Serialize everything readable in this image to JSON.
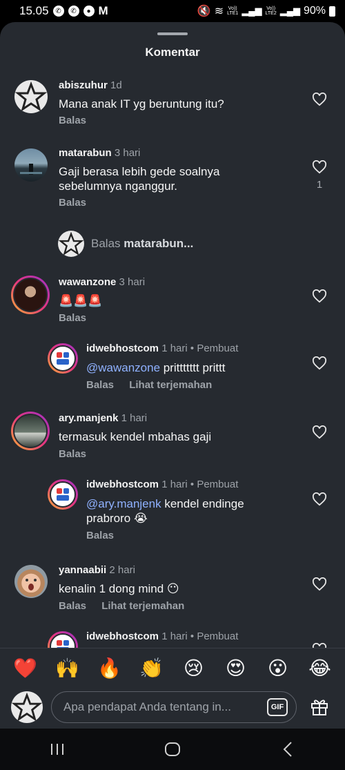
{
  "status": {
    "time": "15.05",
    "left_icons": [
      "whatsapp-icon",
      "whatsapp-icon",
      "record-icon",
      "gmail-icon"
    ],
    "lte1": "LTE1",
    "lte2": "LTE2",
    "vo1": "Vo))",
    "vo2": "Vo))",
    "battery": "90%"
  },
  "sheet": {
    "title": "Komentar"
  },
  "comments": [
    {
      "username": "abiszuhur",
      "time": "1d",
      "text": "Mana anak IT yg beruntung itu?",
      "actions": [
        "Balas"
      ],
      "likes": "",
      "avatar": "star-avatar-icon"
    },
    {
      "username": "matarabun",
      "time": "3 hari",
      "text": "Gaji berasa lebih gede soalnya sebelumnya nganggur.",
      "actions": [
        "Balas"
      ],
      "likes": "1",
      "avatar": "landscape-avatar-icon"
    },
    {
      "username": "wawanzone",
      "time": "3 hari",
      "text": "🚨🚨🚨",
      "actions": [
        "Balas"
      ],
      "likes": "",
      "avatar": "person-avatar-icon"
    },
    {
      "username": "idwebhostcom",
      "time": "1 hari",
      "creator": "Pembuat",
      "mention": "@wawanzone",
      "text": "prittttttt prittt",
      "actions": [
        "Balas",
        "Lihat terjemahan"
      ],
      "likes": "",
      "avatar": "idwebhost-logo-icon"
    },
    {
      "username": "ary.manjenk",
      "time": "1 hari",
      "text": "termasuk kendel mbahas gaji",
      "actions": [
        "Balas"
      ],
      "likes": "",
      "avatar": "person-avatar-icon"
    },
    {
      "username": "idwebhostcom",
      "time": "1 hari",
      "creator": "Pembuat",
      "mention": "@ary.manjenk",
      "text": "kendel endinge prabroro 😭",
      "actions": [
        "Balas"
      ],
      "likes": "",
      "avatar": "idwebhost-logo-icon"
    },
    {
      "username": "yannaabii",
      "time": "2 hari",
      "text": "kenalin 1 dong mind 😶",
      "actions": [
        "Balas",
        "Lihat terjemahan"
      ],
      "likes": "",
      "avatar": "child-avatar-icon"
    },
    {
      "username": "idwebhostcom",
      "time": "1 hari",
      "creator": "Pembuat",
      "avatar": "idwebhost-logo-icon"
    }
  ],
  "reply_prompt": {
    "prefix": "Balas",
    "target": "matarabun..."
  },
  "emoji_bar": [
    "❤️",
    "🙌",
    "🔥",
    "👏",
    "😢",
    "😍",
    "😮",
    "😂"
  ],
  "composer": {
    "placeholder": "Apa pendapat Anda tentang in...",
    "gif_label": "GIF"
  },
  "nav": [
    "recents-icon",
    "home-icon",
    "back-icon"
  ],
  "colors": {
    "sheet_bg": "#262a30",
    "mention": "#8fb1ff",
    "muted": "#9ea3a9"
  }
}
